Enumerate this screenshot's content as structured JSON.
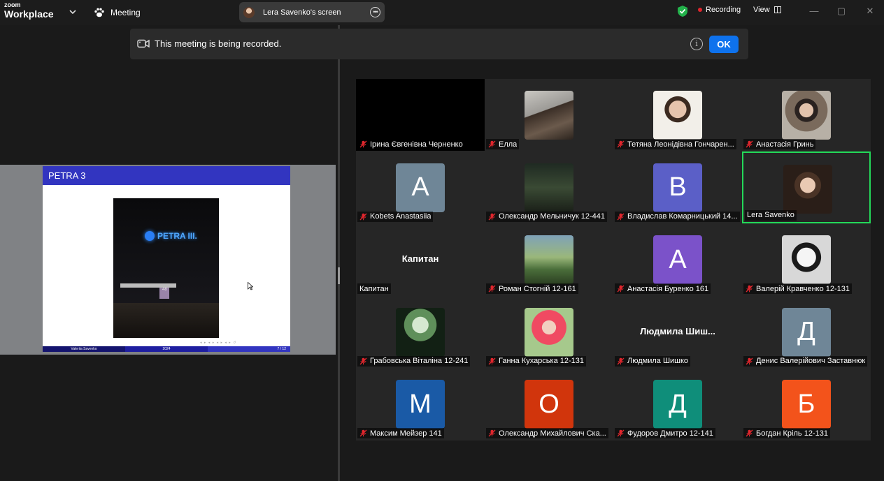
{
  "app": {
    "brand_top": "zoom",
    "brand_bottom": "Workplace"
  },
  "topbar": {
    "meeting_label": "Meeting",
    "share_label": "Lera Savenko's screen",
    "recording_label": "Recording",
    "view_label": "View"
  },
  "banner": {
    "message": "This meeting is being recorded.",
    "info_glyph": "i",
    "ok_label": "OK"
  },
  "slide": {
    "title": "PETRA 3",
    "sign_text": "PETRA III.",
    "door_number": "48",
    "footer_author": "Valeriia Savenko",
    "footer_year": "2024",
    "footer_page": "7 / 12"
  },
  "colors": {
    "accent": "#0e72ed",
    "active_speaker": "#23d959",
    "recording": "#e0262d",
    "muted_mic": "#e0262d",
    "shield": "#23b24b",
    "slide_header": "#3235c0"
  },
  "participants": [
    {
      "name": "Ірина Євгенівна Черненко",
      "kind": "video-off-black",
      "muted": true
    },
    {
      "name": "Елла",
      "kind": "photo",
      "muted": true
    },
    {
      "name": "Тетяна Леонідівна Гончарен...",
      "kind": "photo",
      "muted": true
    },
    {
      "name": "Анастасія Гринь",
      "kind": "photo",
      "muted": true
    },
    {
      "name": "Kobets Anastasiia",
      "kind": "letter",
      "letter": "A",
      "color": "#6f8697",
      "muted": true
    },
    {
      "name": "Олександр Мельничук 12-441",
      "kind": "photo",
      "muted": true
    },
    {
      "name": "Владислав Комарницький 14...",
      "kind": "letter",
      "letter": "B",
      "color": "#5b5fc7",
      "muted": true
    },
    {
      "name": "Lera Savenko",
      "kind": "photo",
      "muted": false,
      "active": true
    },
    {
      "name": "Капитан",
      "kind": "name-text",
      "display": "Капитан",
      "muted": false
    },
    {
      "name": "Роман Стогній 12-161",
      "kind": "photo",
      "muted": true
    },
    {
      "name": "Анастасія Буренко 161",
      "kind": "letter",
      "letter": "А",
      "color": "#7b52c9",
      "muted": true
    },
    {
      "name": "Валерій Кравченко 12-131",
      "kind": "photo",
      "muted": true
    },
    {
      "name": "Грабовська Віталіна 12-241",
      "kind": "photo",
      "muted": true
    },
    {
      "name": "Ганна Кухарська 12-131",
      "kind": "photo",
      "muted": true
    },
    {
      "name": "Людмила Шишко",
      "kind": "name-text",
      "display": "Людмила Шиш...",
      "muted": true
    },
    {
      "name": "Денис Валерійович Заставнюк",
      "kind": "letter",
      "letter": "Д",
      "color": "#6f8697",
      "muted": true
    },
    {
      "name": "Максим Мейзер 141",
      "kind": "letter",
      "letter": "M",
      "color": "#1a5aa6",
      "muted": true
    },
    {
      "name": "Олександр Михайлович Ска...",
      "kind": "letter",
      "letter": "O",
      "color": "#d1350c",
      "muted": true
    },
    {
      "name": "Фудоров Дмитро 12-141",
      "kind": "letter",
      "letter": "Д",
      "color": "#0f8e7a",
      "muted": true
    },
    {
      "name": "Богдан Кріль 12-131",
      "kind": "letter",
      "letter": "Б",
      "color": "#f3531b",
      "muted": true
    }
  ]
}
